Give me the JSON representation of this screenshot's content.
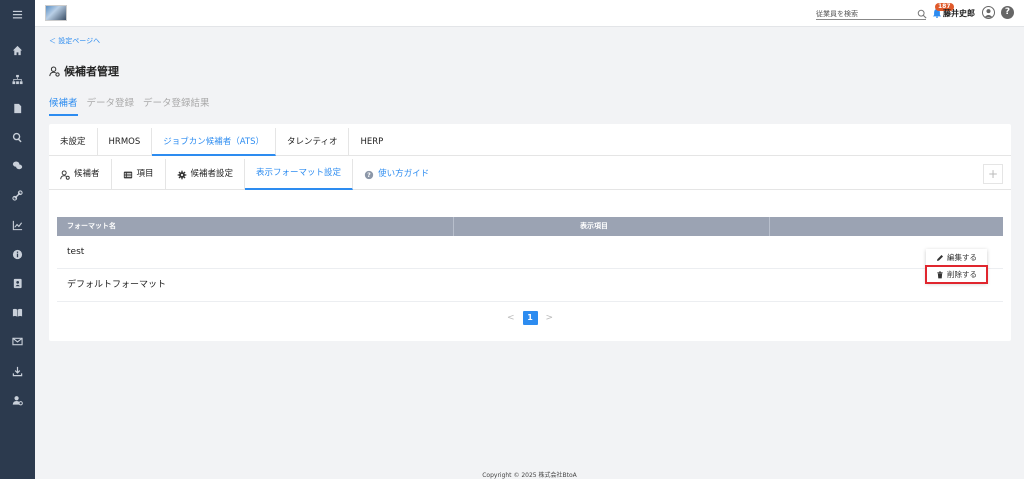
{
  "header": {
    "search_placeholder": "従業員を検索",
    "notification_count": "187",
    "user_name": "藤井史郎",
    "help_label": "?"
  },
  "back_link": "＜ 設定ページへ",
  "page_title": "候補者管理",
  "top_tabs": [
    {
      "label": "候補者",
      "active": true
    },
    {
      "label": "データ登録",
      "active": false
    },
    {
      "label": "データ登録結果",
      "active": false
    }
  ],
  "integration_tabs": [
    {
      "label": "未設定"
    },
    {
      "label": "HRMOS"
    },
    {
      "label": "ジョブカン候補者（ATS）",
      "active": true
    },
    {
      "label": "タレンティオ"
    },
    {
      "label": "HERP"
    }
  ],
  "sub_tabs": {
    "candidates": "候補者",
    "items": "項目",
    "candidate_settings": "候補者設定",
    "display_format": "表示フォーマット設定",
    "guide": "使い方ガイド"
  },
  "plus_label": "+",
  "table": {
    "columns": [
      "フォーマット名",
      "表示項目"
    ],
    "rows": [
      {
        "name": "test"
      },
      {
        "name": "デフォルトフォーマット"
      }
    ]
  },
  "pager": {
    "prev": "<",
    "current": "1",
    "next": ">"
  },
  "context_menu": {
    "edit": "編集する",
    "delete": "削除する"
  },
  "footer": "Copyright © 2025 株式会社BtoA",
  "colors": {
    "sidebar": "#2c3a4e",
    "accent": "#2d8cf0",
    "table_header": "#9ba3b3",
    "highlight": "#e0262e"
  }
}
